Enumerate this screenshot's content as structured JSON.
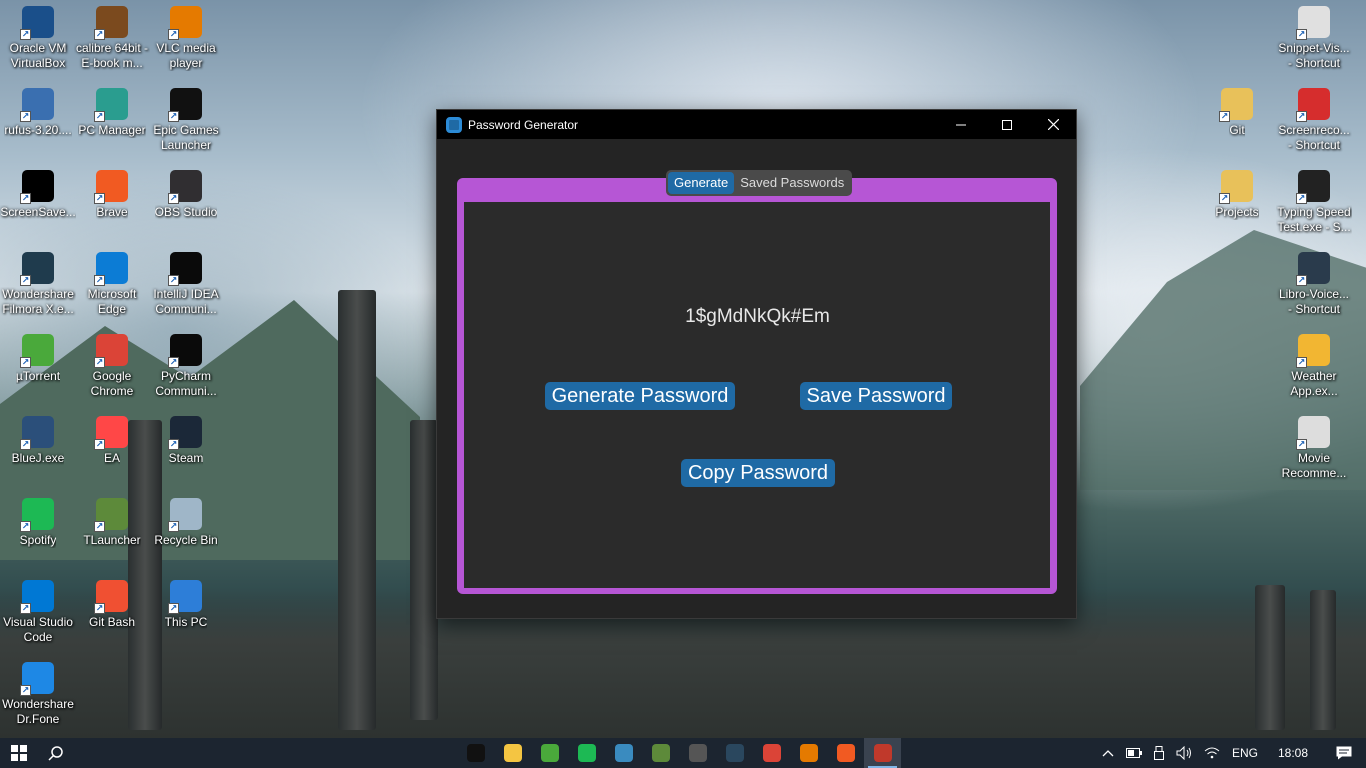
{
  "desktop": {
    "icons_left": [
      {
        "label": "Oracle VM VirtualBox",
        "icon": "virtualbox-icon",
        "color": "#1a4f8a"
      },
      {
        "label": "calibre 64bit - E-book m...",
        "icon": "calibre-icon",
        "color": "#7b4a1e"
      },
      {
        "label": "VLC media player",
        "icon": "vlc-icon",
        "color": "#e57a00"
      },
      {
        "label": "rufus-3.20....",
        "icon": "rufus-icon",
        "color": "#3a6fb0"
      },
      {
        "label": "PC Manager",
        "icon": "pc-manager-icon",
        "color": "#2a9d8f"
      },
      {
        "label": "Epic Games Launcher",
        "icon": "epic-games-icon",
        "color": "#111111"
      },
      {
        "label": "ScreenSave...",
        "icon": "screensaver-icon",
        "color": "#000000"
      },
      {
        "label": "Brave",
        "icon": "brave-icon",
        "color": "#f15a22"
      },
      {
        "label": "OBS Studio",
        "icon": "obs-icon",
        "color": "#302e31"
      },
      {
        "label": "Wondershare Filmora X.e...",
        "icon": "filmora-icon",
        "color": "#1f3b4d"
      },
      {
        "label": "Microsoft Edge",
        "icon": "edge-icon",
        "color": "#0c7cd5"
      },
      {
        "label": "IntelliJ IDEA Communi...",
        "icon": "intellij-icon",
        "color": "#0a0a0a"
      },
      {
        "label": "µTorrent",
        "icon": "utorrent-icon",
        "color": "#4aa93b"
      },
      {
        "label": "Google Chrome",
        "icon": "chrome-icon",
        "color": "#db4437"
      },
      {
        "label": "PyCharm Communi...",
        "icon": "pycharm-icon",
        "color": "#0a0a0a"
      },
      {
        "label": "BlueJ.exe",
        "icon": "bluej-icon",
        "color": "#2b4f7a"
      },
      {
        "label": "EA",
        "icon": "ea-icon",
        "color": "#ff4747"
      },
      {
        "label": "Steam",
        "icon": "steam-icon",
        "color": "#1b2838"
      },
      {
        "label": "Spotify",
        "icon": "spotify-icon",
        "color": "#1db954"
      },
      {
        "label": "TLauncher",
        "icon": "tlauncher-icon",
        "color": "#5d8a3a"
      },
      {
        "label": "Recycle Bin",
        "icon": "recycle-bin-icon",
        "color": "#9fb6c8"
      },
      {
        "label": "Visual Studio Code",
        "icon": "vscode-icon",
        "color": "#0078d4"
      },
      {
        "label": "Git Bash",
        "icon": "git-bash-icon",
        "color": "#f05032"
      },
      {
        "label": "This PC",
        "icon": "this-pc-icon",
        "color": "#2d7ed8"
      },
      {
        "label": "Wondershare Dr.Fone",
        "icon": "drfone-icon",
        "color": "#1e88e5"
      }
    ],
    "icons_right": [
      {
        "label": "Snippet-Vis... - Shortcut",
        "icon": "snippet-icon",
        "color": "#e0e0e0"
      },
      {
        "label": "Git",
        "icon": "folder-icon",
        "color": "#e8c15a"
      },
      {
        "label": "Screenreco... - Shortcut",
        "icon": "screen-recorder-icon",
        "color": "#d62d2d"
      },
      {
        "label": "Projects",
        "icon": "folder-icon",
        "color": "#e8c15a"
      },
      {
        "label": "Typing Speed Test.exe - S...",
        "icon": "keyboard-icon",
        "color": "#222222"
      },
      {
        "label": "Libro-Voice... - Shortcut",
        "icon": "libro-icon",
        "color": "#2a3b4c"
      },
      {
        "label": "Weather App.ex...",
        "icon": "weather-icon",
        "color": "#f2b632"
      },
      {
        "label": "Movie Recomme...",
        "icon": "movie-icon",
        "color": "#dddddd"
      }
    ]
  },
  "window": {
    "title": "Password Generator",
    "tabs": [
      "Generate",
      "Saved Passwords"
    ],
    "active_tab": "Generate",
    "password": "1$gMdNkQk#Em",
    "buttons": {
      "generate": "Generate Password",
      "save": "Save Password",
      "copy": "Copy Password"
    },
    "accent_color": "#b656d5",
    "button_color": "#1f6aa5"
  },
  "taskbar": {
    "language": "ENG",
    "time": "18:08",
    "pinned": [
      {
        "icon": "intellij-icon",
        "color": "#111111"
      },
      {
        "icon": "file-explorer-icon",
        "color": "#f4c542"
      },
      {
        "icon": "utorrent-icon",
        "color": "#4aa93b"
      },
      {
        "icon": "spotify-icon",
        "color": "#1db954"
      },
      {
        "icon": "filmora-icon",
        "color": "#3a8bbf"
      },
      {
        "icon": "tlauncher-icon",
        "color": "#5d8a3a"
      },
      {
        "icon": "obs-icon",
        "color": "#555555"
      },
      {
        "icon": "steam-icon",
        "color": "#2a475e"
      },
      {
        "icon": "chrome-icon",
        "color": "#db4437"
      },
      {
        "icon": "vlc-icon",
        "color": "#e57a00"
      },
      {
        "icon": "brave-icon",
        "color": "#f15a22"
      },
      {
        "icon": "python-app-icon",
        "color": "#c0392b"
      }
    ]
  }
}
